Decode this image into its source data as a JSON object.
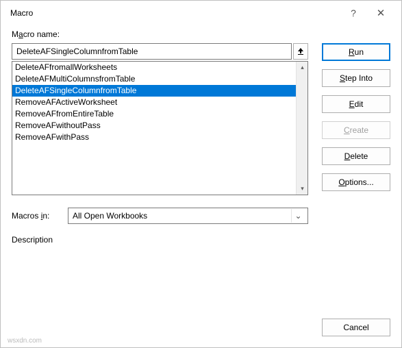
{
  "title": "Macro",
  "labels": {
    "macro_name_pre": "M",
    "macro_name_u": "a",
    "macro_name_post": "cro name:",
    "macros_in_pre": "Macros ",
    "macros_in_u": "i",
    "macros_in_post": "n:",
    "description": "Description"
  },
  "macro_name_value": "DeleteAFSingleColumnfromTable",
  "macro_list": [
    "DeleteAFfromallWorksheets",
    "DeleteAFMultiColumnsfromTable",
    "DeleteAFSingleColumnfromTable",
    "RemoveAFActiveWorksheet",
    "RemoveAFfromEntireTable",
    "RemoveAFwithoutPass",
    "RemoveAFwithPass"
  ],
  "selected_index": 2,
  "macros_in_value": "All Open Workbooks",
  "buttons": {
    "run_u": "R",
    "run_post": "un",
    "step_u": "S",
    "step_post": "tep Into",
    "edit_u": "E",
    "edit_post": "dit",
    "create_u": "C",
    "create_post": "reate",
    "delete_u": "D",
    "delete_post": "elete",
    "options_u": "O",
    "options_post": "ptions...",
    "cancel": "Cancel"
  },
  "help_icon": "?",
  "close_icon": "✕",
  "chev_down": "⌄",
  "scroll_up": "▴",
  "scroll_down": "▾",
  "watermark": "wsxdn.com"
}
